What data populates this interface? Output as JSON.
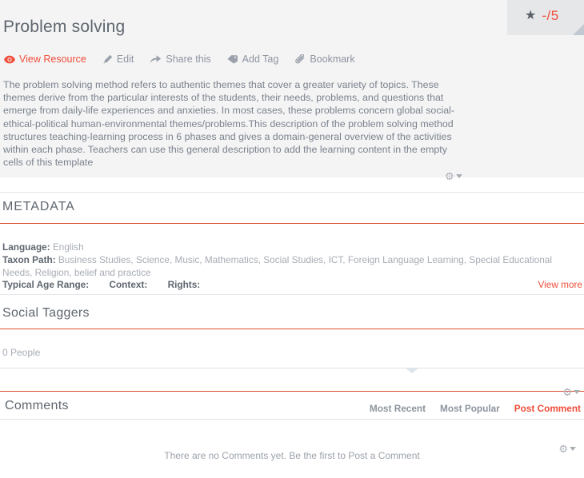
{
  "header": {
    "title": "Problem solving",
    "rating": {
      "icon": "star-icon",
      "value": "-/5"
    }
  },
  "toolbar": {
    "items": [
      {
        "label": "View Resource",
        "icon": "eye-icon",
        "active": true
      },
      {
        "label": "Edit",
        "icon": "pencil-icon",
        "active": false
      },
      {
        "label": "Share this",
        "icon": "share-arrow-icon",
        "active": false
      },
      {
        "label": "Add Tag",
        "icon": "tag-icon",
        "active": false
      },
      {
        "label": "Bookmark",
        "icon": "paperclip-icon",
        "active": false
      }
    ]
  },
  "description": {
    "text": "The problem solving method refers to authentic themes that cover a greater variety of topics. These themes derive from the particular interests of the students, their needs, problems, and questions that emerge from daily-life experiences and anxieties. In most cases, these problems concern global social-ethical-political human-environmental themes/problems.This description of the problem solving method structures teaching-learning process in 6 phases and gives a domain-general overview of the activities within each phase. Teachers can use this general description to add the learning content in the empty cells of this template"
  },
  "metadata": {
    "title": "METADATA",
    "language_label": "Language:",
    "language_value": "English",
    "taxon_label": "Taxon Path:",
    "taxon_value": "Business Studies, Science, Music, Mathematics, Social Studies, ICT, Foreign Language Learning, Special Educational Needs, Religion, belief and practice",
    "age_range_label": "Typical Age Range:",
    "context_label": "Context:",
    "rights_label": "Rights:",
    "view_more_label": "View more"
  },
  "social_taggers": {
    "title": "Social Taggers",
    "people_count": "0 People"
  },
  "comments": {
    "title": "Comments",
    "links": [
      {
        "label": "Most Recent",
        "accent": false
      },
      {
        "label": "Most Popular",
        "accent": false
      },
      {
        "label": "Post Comment",
        "accent": true
      }
    ],
    "empty_message": "There are no Comments yet. Be the first to Post a Comment"
  },
  "colors": {
    "accent": "#ef4e3a",
    "rule": "#d94f32",
    "panel": "#f4f4f5",
    "badge": "#e6e7e9",
    "text": "#6f7680",
    "muted": "#a7acb4"
  }
}
